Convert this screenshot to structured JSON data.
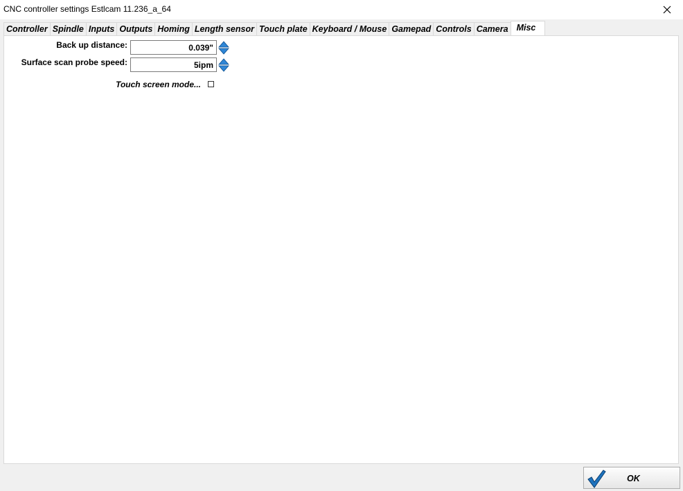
{
  "window": {
    "title": "CNC controller settings Estlcam 11.236_a_64"
  },
  "tabs": [
    {
      "label": "Controller"
    },
    {
      "label": "Spindle"
    },
    {
      "label": "Inputs"
    },
    {
      "label": "Outputs"
    },
    {
      "label": "Homing"
    },
    {
      "label": "Length sensor"
    },
    {
      "label": "Touch plate"
    },
    {
      "label": "Keyboard / Mouse"
    },
    {
      "label": "Gamepad"
    },
    {
      "label": "Controls"
    },
    {
      "label": "Camera"
    },
    {
      "label": "Misc",
      "active": true
    }
  ],
  "misc": {
    "back_up_distance": {
      "label": "Back up distance:",
      "value": "0.039\""
    },
    "surface_scan_speed": {
      "label": "Surface scan probe speed:",
      "value": "5ipm"
    },
    "touch_screen_mode": {
      "label": "Touch screen mode...",
      "checked": false
    }
  },
  "footer": {
    "ok_label": "OK"
  },
  "colors": {
    "accent": "#1e73be",
    "panel_bg": "#ffffff",
    "window_bg": "#f0f0f0"
  }
}
